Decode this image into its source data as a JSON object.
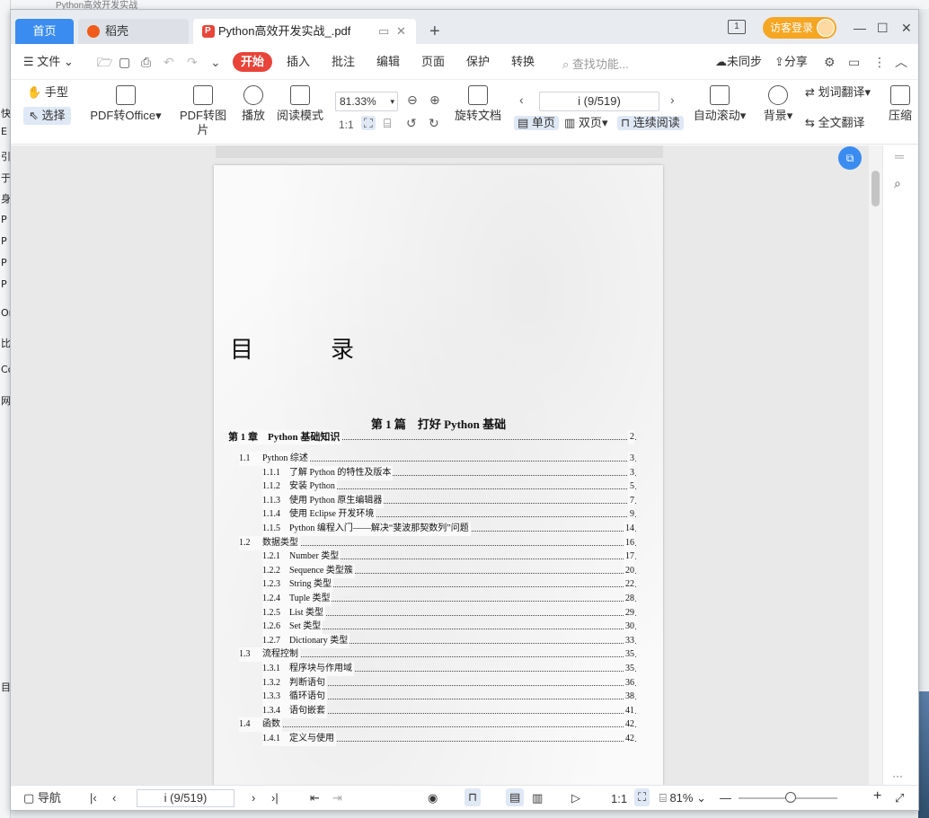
{
  "desktop": {
    "top_text": "Python高效开发实战",
    "left_chars": [
      "快",
      "E",
      "引",
      "于",
      "身",
      "P",
      "P",
      "P",
      "P",
      "Or",
      "比",
      "Cc",
      "网",
      "目"
    ]
  },
  "tabs": {
    "home": "首页",
    "daoke": "稻壳",
    "pdf": "Python高效开发实战_.pdf",
    "new_tab": "+"
  },
  "window": {
    "guest_login": "访客登录",
    "minimize": "—",
    "maximize": "☐",
    "close": "✕",
    "badge": "1"
  },
  "menu": {
    "file": "文件",
    "start": "开始",
    "insert": "插入",
    "annotate": "批注",
    "edit": "编辑",
    "page": "页面",
    "protect": "保护",
    "convert": "转换",
    "search_placeholder": "查找功能...",
    "sync": "未同步",
    "share": "分享"
  },
  "toolbar": {
    "hand": "手型",
    "select": "选择",
    "pdf_to_office": "PDF转Office",
    "pdf_to_image": "PDF转图片",
    "play": "播放",
    "read_mode": "阅读模式",
    "zoom": "81.33%",
    "rotate_doc": "旋转文档",
    "page_indicator": "i (9/519)",
    "single_page": "单页",
    "double_page": "双页",
    "continuous": "连续阅读",
    "auto_scroll": "自动滚动",
    "background": "背景",
    "word_translate": "划词翻译",
    "full_translate": "全文翻译",
    "compress": "压缩"
  },
  "toc": {
    "title": "目　录",
    "part": "第 1 篇　打好 Python 基础",
    "rows": [
      {
        "level": 0,
        "num": "第 1 章",
        "text": "Python 基础知识",
        "page": "2"
      },
      {
        "level": 1,
        "num": "1.1",
        "text": "Python 综述",
        "page": "3"
      },
      {
        "level": 2,
        "num": "1.1.1",
        "text": "了解 Python 的特性及版本",
        "page": "3"
      },
      {
        "level": 2,
        "num": "1.1.2",
        "text": "安装 Python",
        "page": "5"
      },
      {
        "level": 2,
        "num": "1.1.3",
        "text": "使用 Python 原生编辑器",
        "page": "7"
      },
      {
        "level": 2,
        "num": "1.1.4",
        "text": "使用 Eclipse 开发环境",
        "page": "9"
      },
      {
        "level": 2,
        "num": "1.1.5",
        "text": "Python 编程入门——解决“斐波那契数列”问题",
        "page": "14"
      },
      {
        "level": 1,
        "num": "1.2",
        "text": "数据类型",
        "page": "16"
      },
      {
        "level": 2,
        "num": "1.2.1",
        "text": "Number 类型",
        "page": "17"
      },
      {
        "level": 2,
        "num": "1.2.2",
        "text": "Sequence 类型簇",
        "page": "20"
      },
      {
        "level": 2,
        "num": "1.2.3",
        "text": "String 类型",
        "page": "22"
      },
      {
        "level": 2,
        "num": "1.2.4",
        "text": "Tuple 类型",
        "page": "28"
      },
      {
        "level": 2,
        "num": "1.2.5",
        "text": "List 类型",
        "page": "29"
      },
      {
        "level": 2,
        "num": "1.2.6",
        "text": "Set 类型",
        "page": "30"
      },
      {
        "level": 2,
        "num": "1.2.7",
        "text": "Dictionary 类型",
        "page": "33"
      },
      {
        "level": 1,
        "num": "1.3",
        "text": "流程控制",
        "page": "35"
      },
      {
        "level": 2,
        "num": "1.3.1",
        "text": "程序块与作用域",
        "page": "35"
      },
      {
        "level": 2,
        "num": "1.3.2",
        "text": "判断语句",
        "page": "36"
      },
      {
        "level": 2,
        "num": "1.3.3",
        "text": "循环语句",
        "page": "38"
      },
      {
        "level": 2,
        "num": "1.3.4",
        "text": "语句嵌套",
        "page": "41"
      },
      {
        "level": 1,
        "num": "1.4",
        "text": "函数",
        "page": "42"
      },
      {
        "level": 2,
        "num": "1.4.1",
        "text": "定义与使用",
        "page": "42"
      }
    ]
  },
  "status": {
    "nav": "导航",
    "page_indicator": "i (9/519)",
    "zoom": "81%",
    "more": "···"
  }
}
